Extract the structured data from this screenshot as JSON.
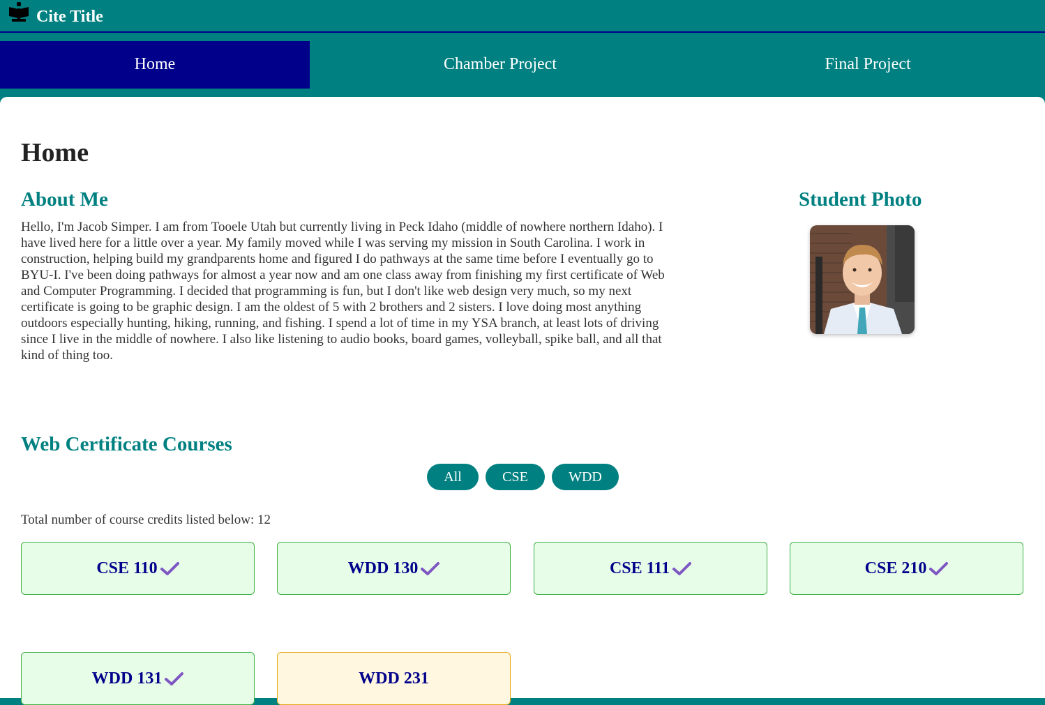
{
  "header": {
    "site_title": "Cite Title",
    "logo_icon": "book-reader-icon"
  },
  "nav": {
    "items": [
      {
        "label": "Home",
        "active": true
      },
      {
        "label": "Chamber Project",
        "active": false
      },
      {
        "label": "Final Project",
        "active": false
      }
    ]
  },
  "main": {
    "page_title": "Home",
    "about": {
      "heading": "About Me",
      "text": "Hello, I'm Jacob Simper. I am from Tooele Utah but currently living in Peck Idaho (middle of nowhere northern Idaho). I have lived here for a little over a year. My family moved while I was serving my mission in South Carolina. I work in construction, helping build my grandparents home and figured I do pathways at the same time before I eventually go to BYU-I. I've been doing pathways for almost a year now and am one class away from finishing my first certificate of Web and Computer Programming. I decided that programming is fun, but I don't like web design very much, so my next certificate is going to be graphic design. I am the oldest of 5 with 2 brothers and 2 sisters. I love doing most anything outdoors especially hunting, hiking, running, and fishing. I spend a lot of time in my YSA branch, at least lots of driving since I live in the middle of nowhere. I also like listening to audio books, board games, volleyball, spike ball, and all that kind of thing too."
    },
    "photo": {
      "heading": "Student Photo"
    },
    "courses": {
      "heading": "Web Certificate Courses",
      "filters": [
        "All",
        "CSE",
        "WDD"
      ],
      "credits_label": "Total number of course credits listed below: 12",
      "items": [
        {
          "name": "CSE 110",
          "completed": true
        },
        {
          "name": "WDD 130",
          "completed": true
        },
        {
          "name": "CSE 111",
          "completed": true
        },
        {
          "name": "CSE 210",
          "completed": true
        },
        {
          "name": "WDD 131",
          "completed": true
        },
        {
          "name": "WDD 231",
          "completed": false
        }
      ]
    }
  },
  "colors": {
    "teal": "#008080",
    "navy": "#00008b",
    "completed_bg": "#e8fde8",
    "incomplete_bg": "#fff7e0",
    "check": "#7e57c2"
  }
}
